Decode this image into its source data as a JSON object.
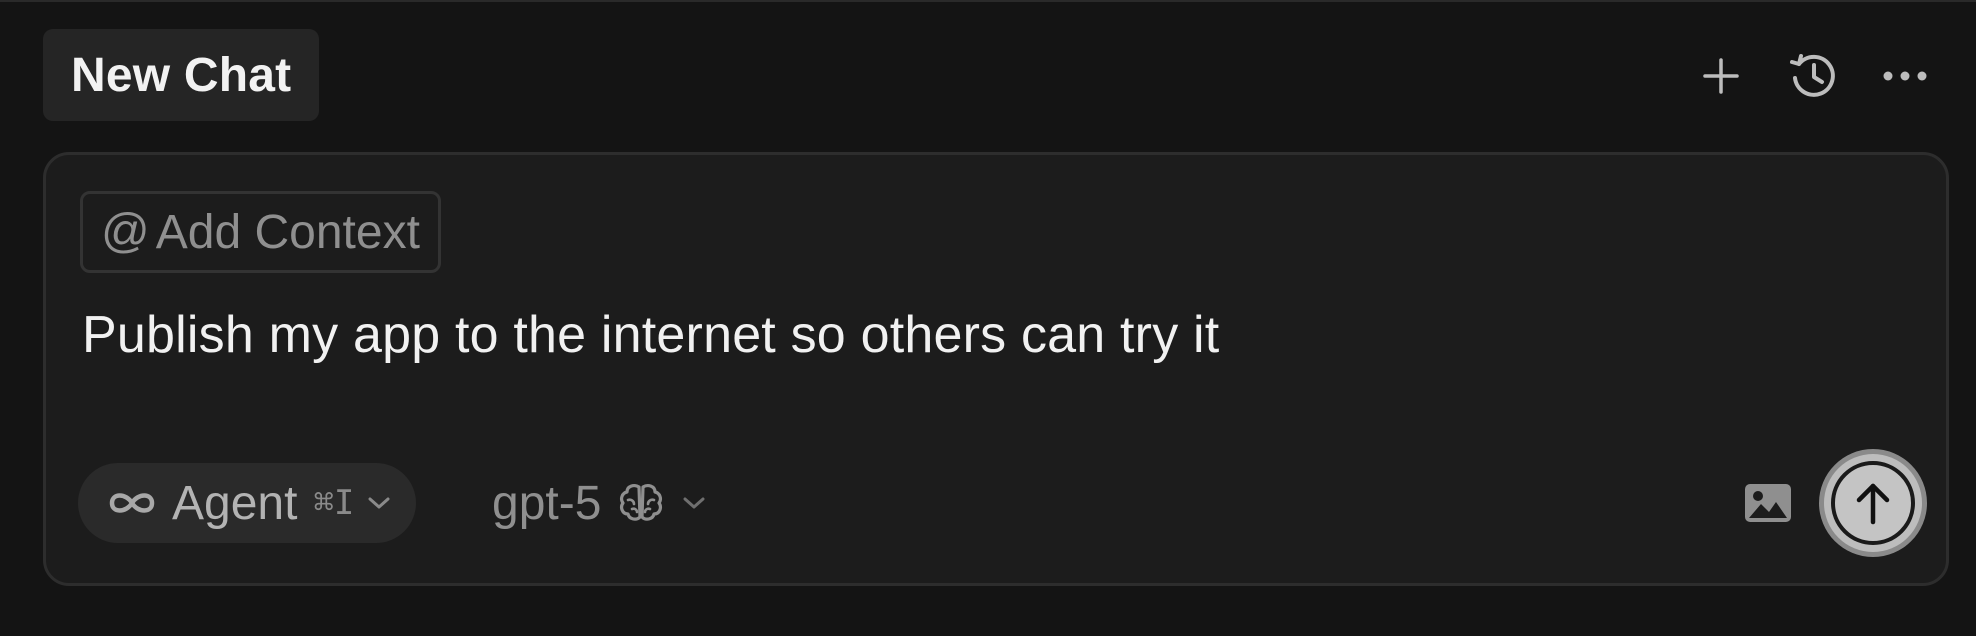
{
  "header": {
    "tab_title": "New Chat",
    "actions": [
      {
        "name": "new-chat",
        "icon": "plus-icon"
      },
      {
        "name": "history",
        "icon": "history-icon"
      },
      {
        "name": "more",
        "icon": "ellipsis-icon"
      }
    ]
  },
  "composer": {
    "add_context_icon": "@",
    "add_context_label": "Add Context",
    "prompt_text": "Publish my app to the internet so others can try it",
    "mode": {
      "label": "Agent",
      "shortcut": "⌘I",
      "icon": "infinity-icon"
    },
    "model": {
      "label": "gpt-5",
      "icon": "brain-icon"
    },
    "tools": {
      "image_icon": "image-icon",
      "send_icon": "arrow-up-icon"
    }
  },
  "colors": {
    "background": "#141414",
    "composer_bg": "#1c1c1c",
    "border": "#2d2d2d",
    "send_button": "#bdbdbd"
  }
}
